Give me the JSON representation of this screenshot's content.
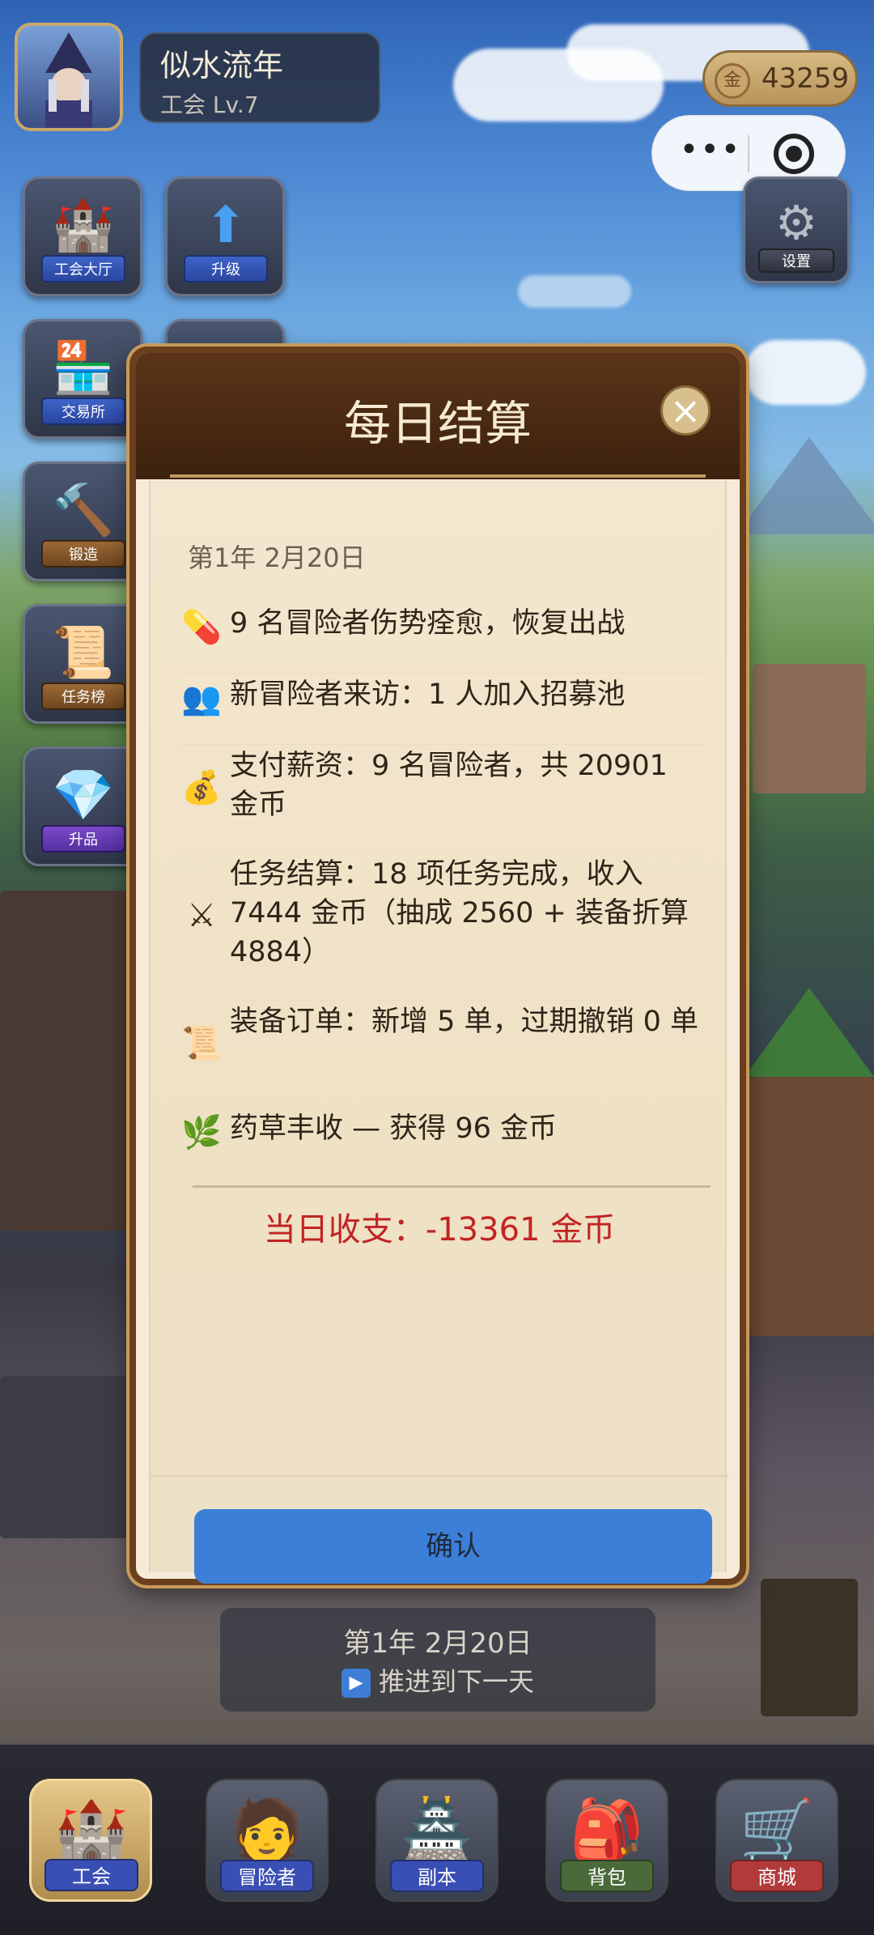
{
  "header": {
    "player_name": "似水流年",
    "guild_level": "工会 Lv.7",
    "gold_icon": "金",
    "gold_amount": "43259"
  },
  "mini_program_capsule": {
    "more_icon": "more-dots-icon",
    "close_icon": "target-circle-icon"
  },
  "side_menu": [
    {
      "label": "工会大厅",
      "icon": "castle-icon"
    },
    {
      "label": "升级",
      "icon": "arrow-up-icon"
    },
    {
      "label": "设置",
      "icon": "gear-icon"
    },
    {
      "label": "交易所",
      "icon": "market-stall-icon"
    },
    {
      "label": "锻造",
      "icon": "anvil-icon"
    },
    {
      "label": "任务榜",
      "icon": "quest-board-icon"
    },
    {
      "label": "升品",
      "icon": "diamond-icon"
    }
  ],
  "dialog": {
    "title": "每日结算",
    "close_icon": "close-icon",
    "date": "第1年 2月20日",
    "events": [
      {
        "icon": "pill-icon",
        "text": "9 名冒险者伤势痊愈，恢复出战"
      },
      {
        "icon": "users-icon",
        "text": "新冒险者来访：1 人加入招募池"
      },
      {
        "icon": "money-bag-icon",
        "text": "支付薪资：9 名冒险者，共 20901 金币"
      },
      {
        "icon": "crossed-swords-icon",
        "text": "任务结算：18 项任务完成，收入 7444 金币（抽成 2560 + 装备折算 4884）"
      },
      {
        "icon": "scroll-icon",
        "text": "装备订单：新增 5 单，过期撤销 0 单"
      },
      {
        "icon": "herb-icon",
        "text": "药草丰收 — 获得 96 金币"
      }
    ],
    "total": "当日收支：-13361 金币",
    "confirm_label": "确认"
  },
  "day_bar": {
    "date": "第1年 2月20日",
    "next_label": "推进到下一天",
    "play_icon": "play-icon"
  },
  "nav": [
    {
      "label": "工会",
      "icon": "castle-icon",
      "active": true
    },
    {
      "label": "冒险者",
      "icon": "hero-icon",
      "active": false
    },
    {
      "label": "副本",
      "icon": "dungeon-gate-icon",
      "active": false
    },
    {
      "label": "背包",
      "icon": "backpack-icon",
      "active": false
    },
    {
      "label": "商城",
      "icon": "shopping-cart-icon",
      "active": false
    }
  ],
  "colors": {
    "dialog_header": "#4a2a12",
    "total_text": "#c22323",
    "confirm_button": "#3b7fd8",
    "nav_label_blue": "#3a4fb4",
    "nav_label_red": "#b23a3a"
  }
}
